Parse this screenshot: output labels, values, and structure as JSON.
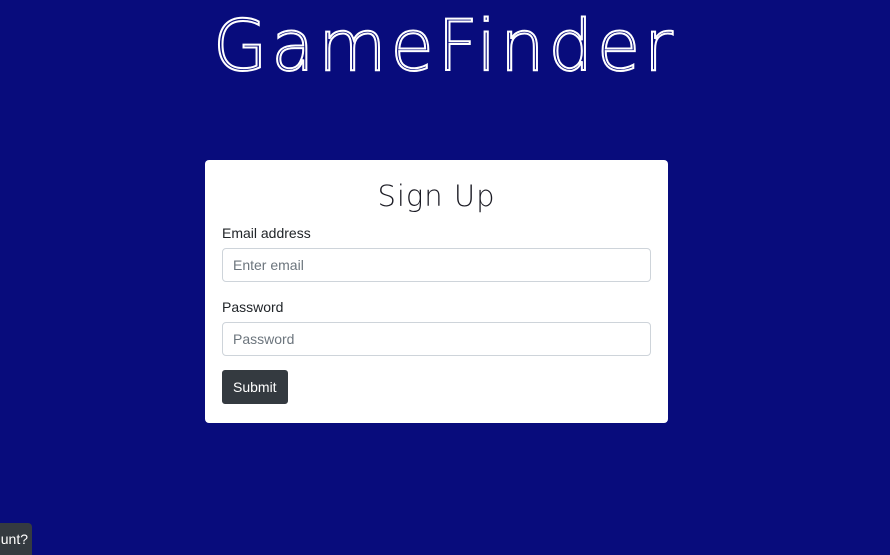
{
  "header": {
    "logo_text": "GameFinder"
  },
  "signup_form": {
    "title": "Sign Up",
    "email_label": "Email address",
    "email_placeholder": "Enter email",
    "email_value": "",
    "password_label": "Password",
    "password_placeholder": "Password",
    "password_value": "",
    "submit_label": "Submit"
  },
  "footer_tab": {
    "visible_text": "unt?"
  },
  "colors": {
    "background": "#080c7c",
    "card": "#ffffff",
    "button": "#343a40"
  }
}
